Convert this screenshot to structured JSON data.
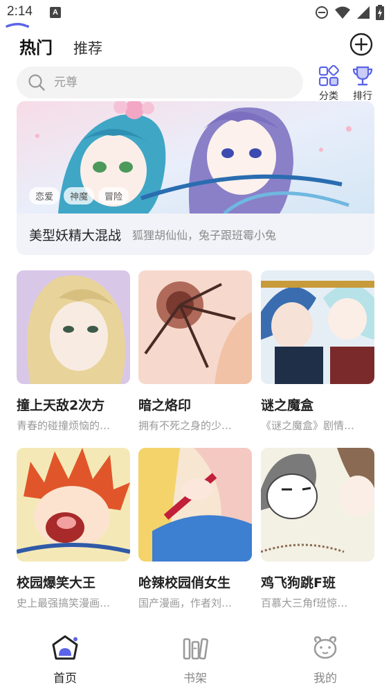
{
  "status_bar": {
    "time": "2:14",
    "notification_letter": "A"
  },
  "header": {
    "tabs": [
      {
        "label": "热门"
      },
      {
        "label": "推荐"
      }
    ],
    "active_tab": "热门"
  },
  "search": {
    "placeholder": "元尊"
  },
  "quick_actions": [
    {
      "label": "分类",
      "icon": "category-grid-icon"
    },
    {
      "label": "排行",
      "icon": "trophy-icon"
    }
  ],
  "banner": {
    "title": "美型妖精大混战",
    "description": "狐狸胡仙仙，兔子跟班霉小兔",
    "tags": [
      "恋爱",
      "神魔",
      "冒险"
    ]
  },
  "comics": [
    {
      "title": "撞上天敌2次方",
      "description": "青春的碰撞烦恼的…"
    },
    {
      "title": "暗之烙印",
      "description": "拥有不死之身的少…"
    },
    {
      "title": "谜之魔盒",
      "description": "《谜之魔盒》剧情…"
    },
    {
      "title": "校园爆笑大王",
      "description": "史上最强搞笑漫画…"
    },
    {
      "title": "呛辣校园俏女生",
      "description": "国产漫画，作者刘…"
    },
    {
      "title": "鸡飞狗跳F班",
      "description": "百慕大三角f班惊…"
    }
  ],
  "bottom_nav": [
    {
      "label": "首页",
      "icon": "home-icon",
      "active": true
    },
    {
      "label": "书架",
      "icon": "bookshelf-icon",
      "active": false
    },
    {
      "label": "我的",
      "icon": "profile-dog-icon",
      "active": false
    }
  ],
  "colors": {
    "accent": "#5b63e8",
    "icon_gray": "#9a9a9a",
    "search_bg": "#f3f3f3"
  }
}
